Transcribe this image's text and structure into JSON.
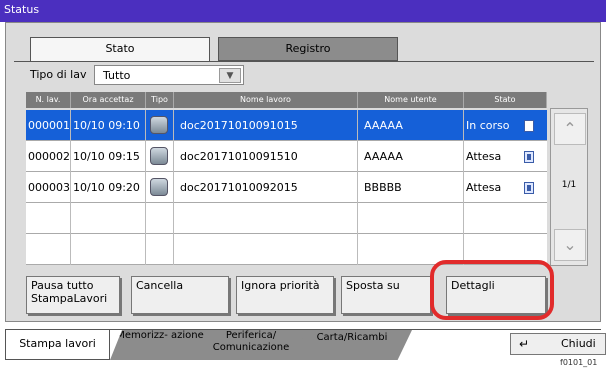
{
  "window": {
    "title": "Status"
  },
  "tabs": [
    {
      "label": "Stato"
    },
    {
      "label": "Registro"
    }
  ],
  "filter": {
    "label": "Tipo di lav",
    "value": "Tutto"
  },
  "table": {
    "headers": [
      "N. lav.",
      "Ora accettaz",
      "Tipo",
      "Nome lavoro",
      "Nome utente",
      "Stato"
    ],
    "rows": [
      {
        "no": "000001",
        "time": "10/10 09:10",
        "name": "doc20171010091015",
        "user": "AAAAA",
        "status": "In corso",
        "selected": true
      },
      {
        "no": "000002",
        "time": "10/10 09:15",
        "name": "doc20171010091510",
        "user": "AAAAA",
        "status": "Attesa",
        "selected": false
      },
      {
        "no": "000003",
        "time": "10/10 09:20",
        "name": "doc20171010092015",
        "user": "BBBBB",
        "status": "Attesa",
        "selected": false
      }
    ]
  },
  "pager": {
    "text": "1/1"
  },
  "buttons": {
    "pause": "Pausa tutto StampaLavori",
    "cancel": "Cancella",
    "ignore": "Ignora priorità",
    "move_up": "Sposta su",
    "details": "Dettagli"
  },
  "bottom_tabs": [
    {
      "label": "Stampa lavori"
    },
    {
      "label": "Memorizz- azione"
    },
    {
      "label": "Periferica/ Comunicazione"
    },
    {
      "label": "Carta/Ricambi"
    }
  ],
  "close": {
    "label": "Chiudi"
  },
  "figure_id": "f0101_01"
}
